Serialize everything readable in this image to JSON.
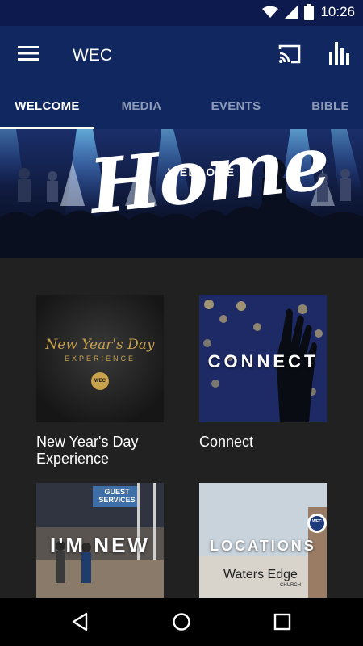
{
  "status_bar": {
    "time": "10:26"
  },
  "app_bar": {
    "title": "WEC",
    "icons": [
      "menu-icon",
      "cast-icon",
      "bar-chart-icon"
    ]
  },
  "tabs": [
    {
      "label": "WELCOME",
      "active": true
    },
    {
      "label": "MEDIA",
      "active": false
    },
    {
      "label": "EVENTS",
      "active": false
    },
    {
      "label": "BIBLE",
      "active": false
    }
  ],
  "hero": {
    "small_text": "WELCOME",
    "big_text": "Home"
  },
  "cards": [
    {
      "label": "New Year's Day Experience",
      "thumb_line1": "New Year's Day",
      "thumb_line2": "EXPERIENCE",
      "thumb_badge": "WEC"
    },
    {
      "label": "Connect",
      "thumb_text": "CONNECT"
    },
    {
      "label": "",
      "thumb_text": "I'M NEW",
      "thumb_sign": "GUEST SERVICES"
    },
    {
      "label": "",
      "thumb_text": "LOCATIONS",
      "thumb_sign": "Waters Edge",
      "thumb_sign_small": "CHURCH",
      "thumb_badge": "WEC"
    }
  ],
  "colors": {
    "status_bar": "#0c1a4d",
    "app_bar": "#10275f",
    "background": "#212121",
    "tab_inactive": "#8d9ab8"
  }
}
